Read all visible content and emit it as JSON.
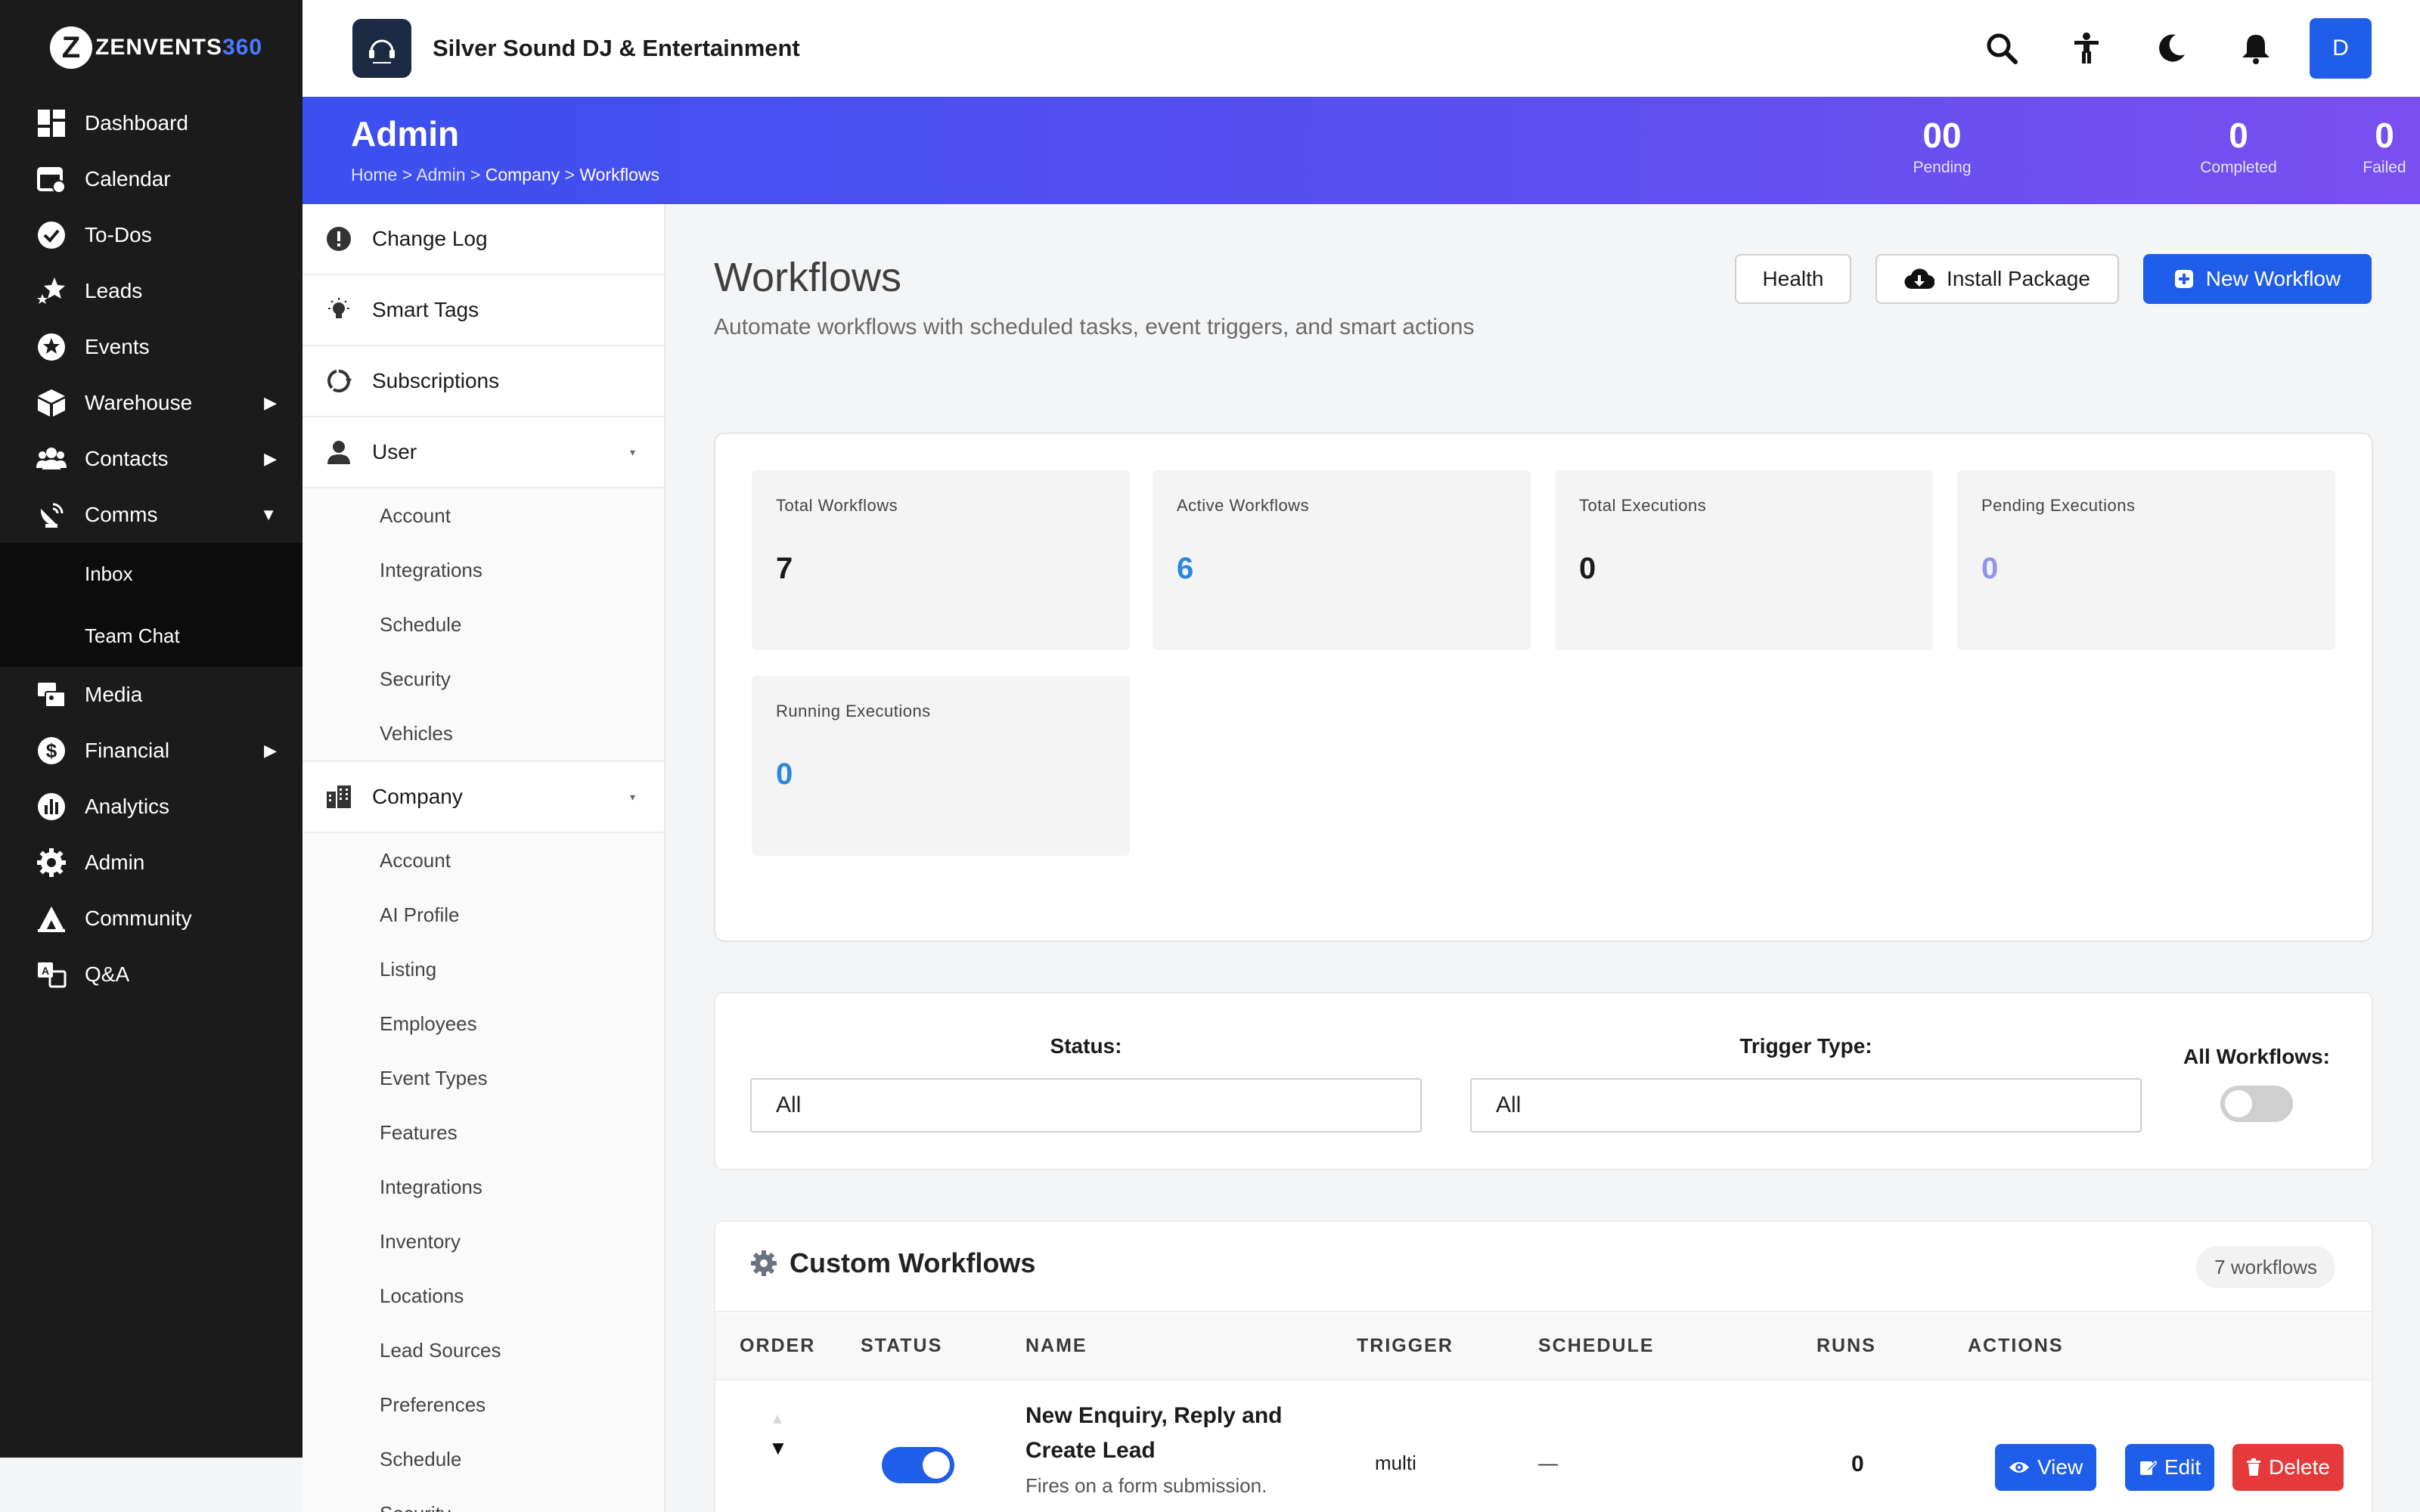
{
  "brand": {
    "mark": "Z",
    "name_prefix": "ZENVENTS",
    "name_suffix": "360"
  },
  "nav": {
    "items": [
      {
        "label": "Dashboard",
        "icon": "dashboard-icon"
      },
      {
        "label": "Calendar",
        "icon": "calendar-icon"
      },
      {
        "label": "To-Dos",
        "icon": "check-circle-icon"
      },
      {
        "label": "Leads",
        "icon": "stars-icon"
      },
      {
        "label": "Events",
        "icon": "star-icon"
      },
      {
        "label": "Warehouse",
        "icon": "box-icon",
        "arrow": "▶"
      },
      {
        "label": "Contacts",
        "icon": "users-icon",
        "arrow": "▶"
      },
      {
        "label": "Comms",
        "icon": "satellite-icon",
        "arrow": "▼"
      }
    ],
    "comms_sub": [
      "Inbox",
      "Team Chat"
    ],
    "items_after": [
      {
        "label": "Media",
        "icon": "photo-video-icon"
      },
      {
        "label": "Financial",
        "icon": "dollar-icon",
        "arrow": "▶"
      },
      {
        "label": "Analytics",
        "icon": "gauge-icon"
      },
      {
        "label": "Admin",
        "icon": "gear-icon"
      },
      {
        "label": "Community",
        "icon": "campground-icon"
      },
      {
        "label": "Q&A",
        "icon": "language-icon"
      }
    ]
  },
  "header": {
    "company_name": "Silver Sound DJ & Entertainment",
    "avatar_letter": "D",
    "icons": [
      "search-icon",
      "accessibility-icon",
      "moon-icon",
      "bell-icon"
    ]
  },
  "banner": {
    "title": "Admin",
    "breadcrumb": [
      "Home",
      "Admin",
      "Company",
      "Workflows"
    ],
    "sep": ">",
    "stats": [
      {
        "value": "00",
        "label": "Pending"
      },
      {
        "value": "0",
        "label": "Completed"
      },
      {
        "value": "0",
        "label": "Failed"
      }
    ]
  },
  "submenu": {
    "top_items": [
      {
        "label": "Change Log",
        "icon": "exclamation-icon"
      },
      {
        "label": "Smart Tags",
        "icon": "lightbulb-icon"
      },
      {
        "label": "Subscriptions",
        "icon": "recycle-icon"
      }
    ],
    "user": {
      "label": "User",
      "caret": "▾",
      "children": [
        "Account",
        "Integrations",
        "Schedule",
        "Security",
        "Vehicles"
      ]
    },
    "company": {
      "label": "Company",
      "caret": "▾",
      "children": [
        "Account",
        "AI Profile",
        "Listing",
        "Employees",
        "Event Types",
        "Features",
        "Integrations",
        "Inventory",
        "Locations",
        "Lead Sources",
        "Preferences",
        "Schedule",
        "Security"
      ]
    }
  },
  "page": {
    "title": "Workflows",
    "subtitle": "Automate workflows with scheduled tasks, event triggers, and smart actions",
    "buttons": {
      "health": "Health",
      "install": "Install Package",
      "new": "New Workflow"
    }
  },
  "stats": [
    {
      "label": "Total Workflows",
      "value": "7",
      "color": "#1b1b1b"
    },
    {
      "label": "Active Workflows",
      "value": "6",
      "color": "#2a86e0"
    },
    {
      "label": "Total Executions",
      "value": "0",
      "color": "#1b1b1b"
    },
    {
      "label": "Pending Executions",
      "value": "0",
      "color": "#8e94f0"
    },
    {
      "label": "Running Executions",
      "value": "0",
      "color": "#2a86e0"
    }
  ],
  "filters": {
    "status_label": "Status:",
    "status_value": "All",
    "trigger_label": "Trigger Type:",
    "trigger_value": "All",
    "all_label": "All Workflows:",
    "all_enabled": false
  },
  "workflows": {
    "title": "Custom Workflows",
    "count_badge": "7 workflows",
    "columns": [
      "ORDER",
      "STATUS",
      "NAME",
      "TRIGGER",
      "SCHEDULE",
      "RUNS",
      "ACTIONS"
    ],
    "rows": [
      {
        "order_up": "▲",
        "order_down": "▼",
        "enabled": true,
        "name": "New Enquiry, Reply and Create Lead",
        "description": "Fires on a form submission.",
        "trigger": "multi",
        "schedule": "—",
        "runs": "0",
        "actions": {
          "view": "View",
          "edit": "Edit",
          "delete": "Delete"
        }
      }
    ]
  },
  "colors": {
    "primary": "#1f5ee8",
    "danger": "#e5393b",
    "sidebar": "#1b1b1b",
    "banner_start": "#3b4ff0",
    "banner_end": "#7a4ff0"
  }
}
